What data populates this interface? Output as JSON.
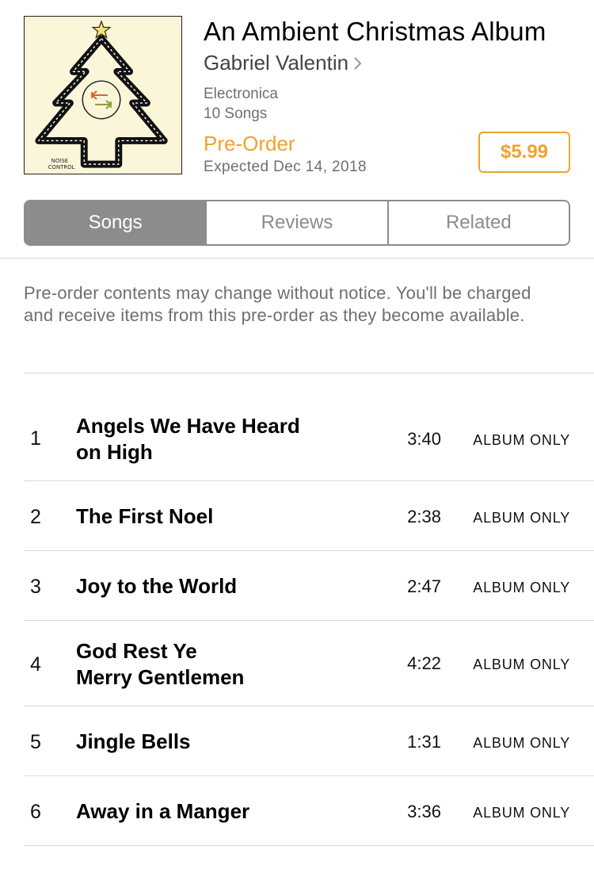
{
  "album": {
    "title": "An Ambient Christmas Album",
    "artist": "Gabriel Valentin",
    "genre": "Electronica",
    "song_count": "10 Songs",
    "status": "Pre-Order",
    "expected": "Expected Dec 14, 2018",
    "price": "$5.99",
    "artwork_text": [
      "NOISE",
      "CONTROL"
    ]
  },
  "tabs": [
    {
      "label": "Songs",
      "active": true
    },
    {
      "label": "Reviews",
      "active": false
    },
    {
      "label": "Related",
      "active": false
    }
  ],
  "notice": "Pre-order contents may change without notice. You'll be charged and receive items from this pre-order as they become available.",
  "tracks": [
    {
      "number": "1",
      "title_lines": [
        "Angels We Have Heard",
        "on High"
      ],
      "duration": "3:40",
      "action": "ALBUM ONLY"
    },
    {
      "number": "2",
      "title_lines": [
        "The First Noel"
      ],
      "duration": "2:38",
      "action": "ALBUM ONLY"
    },
    {
      "number": "3",
      "title_lines": [
        "Joy to the World"
      ],
      "duration": "2:47",
      "action": "ALBUM ONLY"
    },
    {
      "number": "4",
      "title_lines": [
        "God Rest Ye",
        "Merry Gentlemen"
      ],
      "duration": "4:22",
      "action": "ALBUM ONLY"
    },
    {
      "number": "5",
      "title_lines": [
        "Jingle Bells"
      ],
      "duration": "1:31",
      "action": "ALBUM ONLY"
    },
    {
      "number": "6",
      "title_lines": [
        "Away in a Manger"
      ],
      "duration": "3:36",
      "action": "ALBUM ONLY"
    }
  ],
  "colors": {
    "accent": "#f2a22b",
    "secondary_text": "#6f6f6f",
    "segment": "#8c8c8c",
    "artwork_bg": "#fbf6d9"
  },
  "icons": {
    "artist_link": "chevron-right-icon",
    "artwork_star": "star-icon",
    "artwork_center": "arrows-icon"
  }
}
